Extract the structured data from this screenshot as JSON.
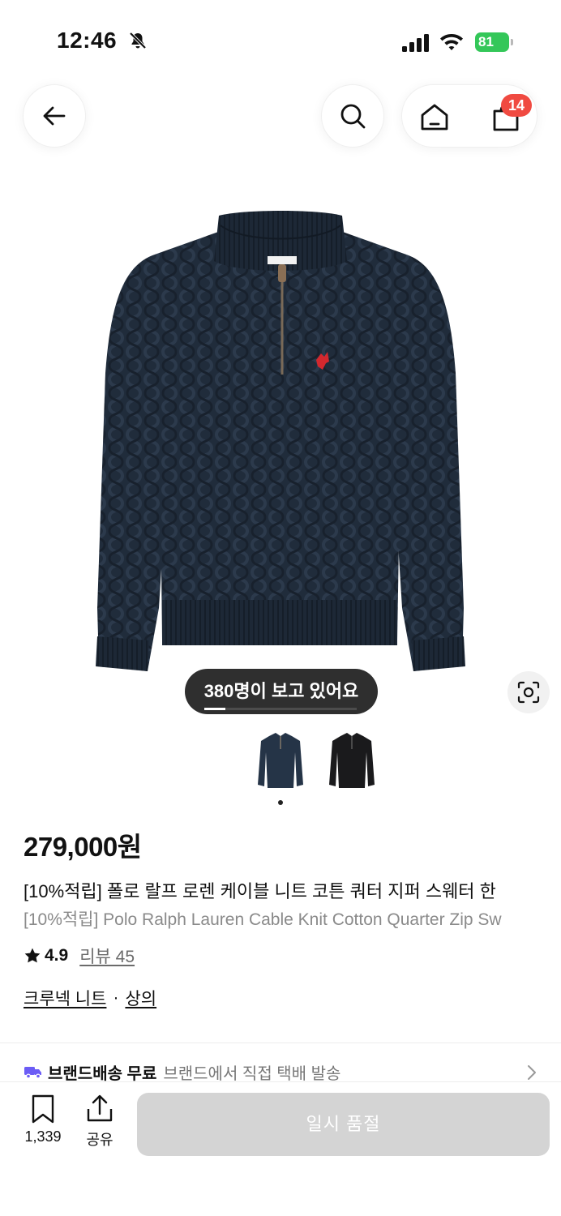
{
  "status_bar": {
    "time": "12:46",
    "battery": "81",
    "battery_color": "#34c759"
  },
  "header": {
    "back_icon": "arrow-left-icon",
    "search_icon": "search-icon",
    "home_icon": "home-icon",
    "cart_icon": "shopping-bag-icon",
    "cart_badge": "14",
    "badge_color": "#f04a41"
  },
  "gallery": {
    "viewers_text": "380명이 보고 있어요",
    "image_progress": 0.14,
    "thumbnails": [
      "navy-sweater",
      "black-sweater"
    ],
    "selected_thumbnail": 0
  },
  "product": {
    "price": "279,000원",
    "title_ko": "[10%적립] 폴로 랄프 로렌 케이블 니트 코튼 쿼터 지퍼 스웨터 한",
    "title_en": "[10%적립] Polo Ralph Lauren Cable Knit Cotton Quarter Zip Sw",
    "rating": "4.9",
    "review_label": "리뷰 45",
    "category_1": "크루넥 니트",
    "category_sep": "·",
    "category_2": "상의"
  },
  "delivery": {
    "strong": "브랜드배송 무료",
    "sub": "브랜드에서 직접 택배 발송",
    "icon_color": "#6b5cf5"
  },
  "bottom_bar": {
    "wish_count": "1,339",
    "share_label": "공유",
    "soldout_label": "일시 품절"
  }
}
